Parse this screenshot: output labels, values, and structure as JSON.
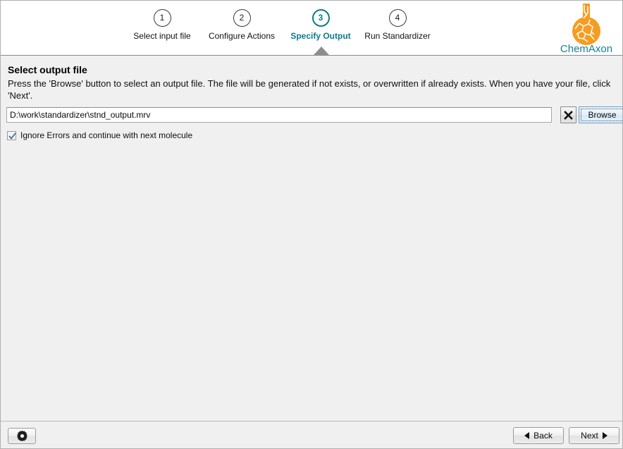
{
  "wizard": {
    "steps": [
      {
        "number": "1",
        "label": "Select input file",
        "active": false
      },
      {
        "number": "2",
        "label": "Configure Actions",
        "active": false
      },
      {
        "number": "3",
        "label": "Specify Output",
        "active": true
      },
      {
        "number": "4",
        "label": "Run Standardizer",
        "active": false
      }
    ],
    "active_step_index": 3
  },
  "brand": {
    "name": "ChemAxon",
    "logo_color": "#f59c21",
    "text_color": "#1a7f8e"
  },
  "colors": {
    "accent": "#0b7c8c",
    "window_background": "#f0f0f0",
    "header_background": "#ffffff",
    "focus_border": "#5f9ed1"
  },
  "content": {
    "title": "Select output file",
    "description": "Press the 'Browse' button to select an output file. The file will be generated if not exists, or overwritten if already exists. When you have your file, click 'Next'.",
    "file_path": {
      "value": "D:\\work\\standardizer\\stnd_output.mrv",
      "placeholder": ""
    },
    "clear_button_label": "✕",
    "browse_button_label": "Browse",
    "ignore_errors": {
      "label": "Ignore Errors and continue with next molecule",
      "checked": true
    }
  },
  "footer": {
    "settings_label": "",
    "back_label": "Back",
    "next_label": "Next"
  },
  "icons": {
    "gear": "gear-icon",
    "close": "close-icon",
    "check": "check-icon",
    "triangle_left": "triangle-left-icon",
    "triangle_right": "triangle-right-icon"
  }
}
